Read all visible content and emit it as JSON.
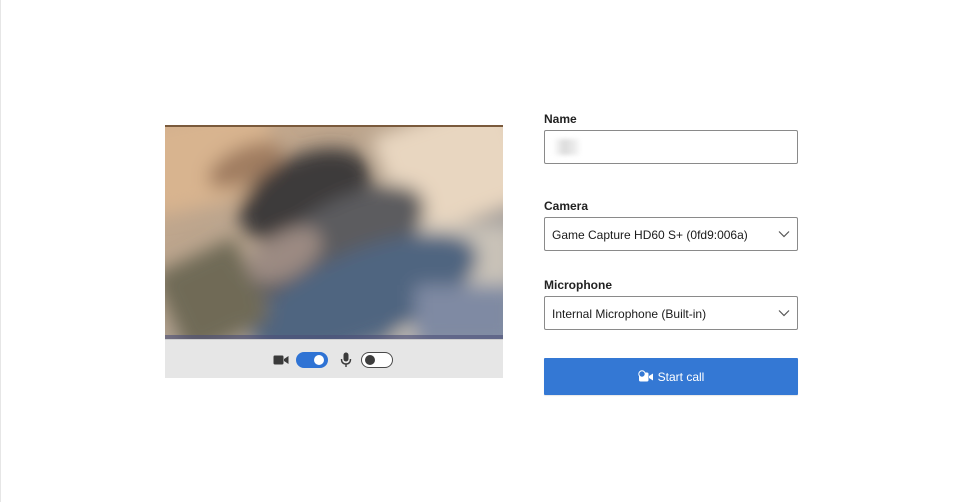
{
  "preview": {
    "camera_enabled": true,
    "microphone_enabled": false
  },
  "form": {
    "name": {
      "label": "Name",
      "value": "",
      "placeholder": ""
    },
    "camera": {
      "label": "Camera",
      "selected": "Game Capture HD60 S+ (0fd9:006a)"
    },
    "microphone": {
      "label": "Microphone",
      "selected": "Internal Microphone (Built-in)"
    },
    "start_call": {
      "label": "Start call",
      "icon": "video-call-icon"
    }
  },
  "colors": {
    "accent": "#3478d4",
    "toggle_on": "#2f73d4",
    "control_bar": "#e6e6e6"
  }
}
